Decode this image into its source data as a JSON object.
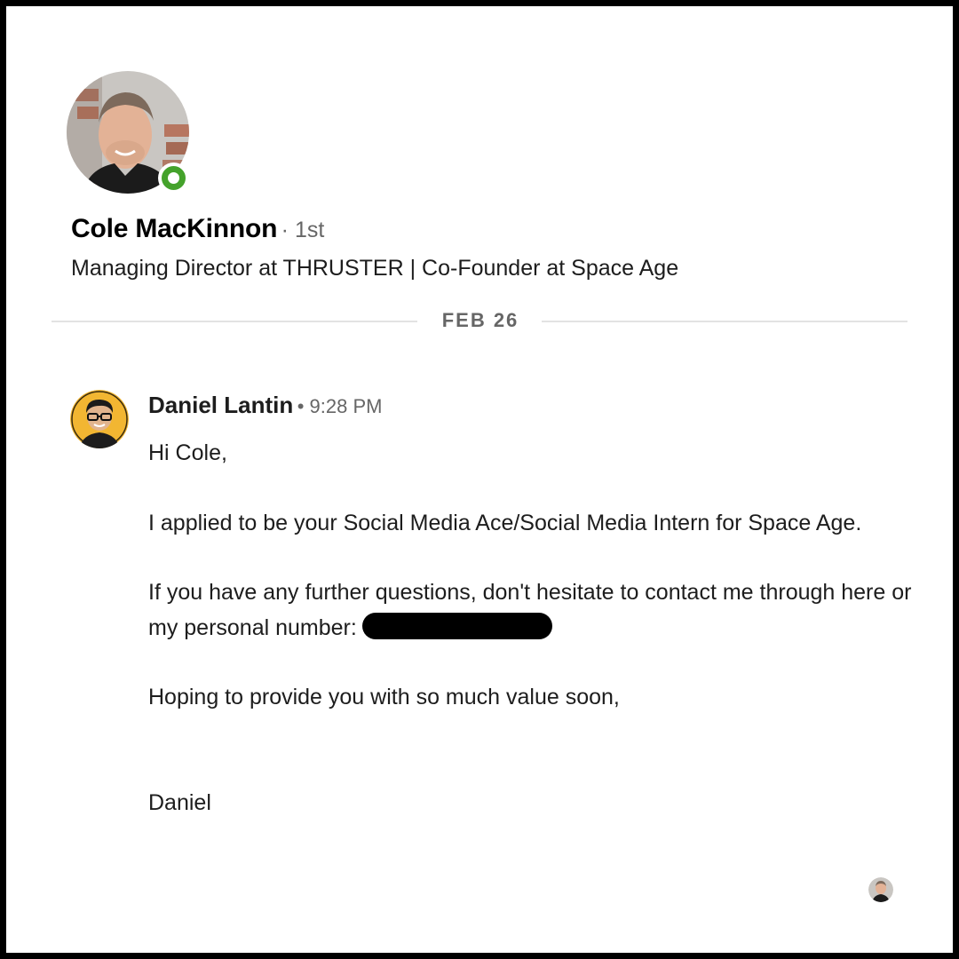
{
  "profile": {
    "name": "Cole MacKinnon",
    "degree": "· 1st",
    "headline": "Managing Director at THRUSTER | Co-Founder at Space Age",
    "avatar_icon": "profile-photo-man",
    "presence": "online",
    "presence_color": "#44a22b"
  },
  "date_divider": "FEB 26",
  "message": {
    "sender": "Daniel Lantin",
    "time": "• 9:28 PM",
    "avatar_icon": "sender-photo-man-glasses",
    "avatar_bg": "#f2b632",
    "greeting": "Hi Cole,",
    "paragraph1": "I applied to be your Social Media Ace/Social Media Intern for Space Age.",
    "paragraph2": "If you have any further questions, don't hesitate to contact me through here or my personal number:",
    "redacted": "phone-number-redacted",
    "paragraph3": "Hoping to provide you with so much value soon,",
    "signoff": "Daniel"
  },
  "read_receipt_icon": "recipient-avatar-icon"
}
